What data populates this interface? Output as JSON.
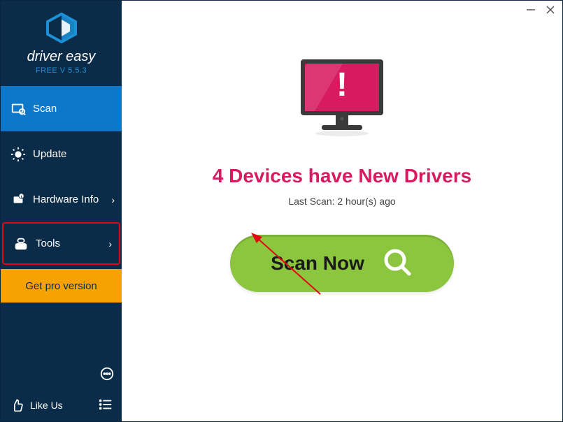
{
  "brand": {
    "name": "driver easy",
    "version": "FREE V 5.5.3"
  },
  "sidebar": {
    "items": [
      {
        "label": "Scan",
        "icon": "scan-icon",
        "active": true,
        "chevron": false
      },
      {
        "label": "Update",
        "icon": "update-icon",
        "active": false,
        "chevron": false
      },
      {
        "label": "Hardware Info",
        "icon": "hardware-icon",
        "active": false,
        "chevron": true
      },
      {
        "label": "Tools",
        "icon": "tools-icon",
        "active": false,
        "chevron": true,
        "highlight": true
      }
    ],
    "pro_label": "Get pro version",
    "like_us_label": "Like Us"
  },
  "main": {
    "headline": "4 Devices have New Drivers",
    "last_scan": "Last Scan: 2 hour(s) ago",
    "scan_button": "Scan Now"
  },
  "colors": {
    "accent": "#d81b60",
    "scan_green": "#8cc63f",
    "pro_orange": "#f6a200",
    "sidebar_bg": "#0a2c48",
    "active_blue": "#0d78c9"
  }
}
